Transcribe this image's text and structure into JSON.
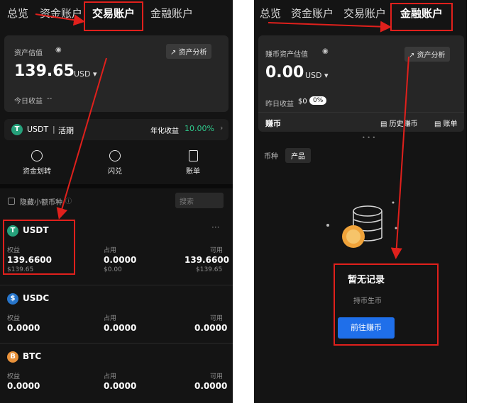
{
  "left": {
    "tabs": [
      "总览",
      "资金账户",
      "交易账户",
      "金融账户"
    ],
    "asset_label": "资产估值",
    "asset_value": "139.65",
    "asset_unit": "USD",
    "analysis_btn": "资产分析",
    "today_label": "今日收益",
    "today_value": "--",
    "promo_coin": "USDT",
    "promo_type": "活期",
    "promo_label": "年化收益",
    "promo_value": "10.00%",
    "actions": [
      "资金划转",
      "闪兑",
      "账单"
    ],
    "hide_small": "隐藏小额币种",
    "search_placeholder": "搜索",
    "columns": [
      "权益",
      "占用",
      "可用"
    ],
    "coins": [
      {
        "name": "USDT",
        "equity": "139.6600",
        "equity_usd": "$139.65",
        "used": "0.0000",
        "used_usd": "$0.00",
        "avail": "139.6600",
        "avail_usd": "$139.65"
      },
      {
        "name": "USDC",
        "equity": "0.0000",
        "used": "0.0000",
        "avail": "0.0000"
      },
      {
        "name": "BTC",
        "equity": "0.0000",
        "used": "0.0000",
        "avail": "0.0000"
      }
    ]
  },
  "right": {
    "tabs": [
      "总览",
      "资金账户",
      "交易账户",
      "金融账户"
    ],
    "asset_label": "赚币资产估值",
    "asset_value": "0.00",
    "asset_unit": "USD",
    "analysis_btn": "资产分析",
    "yesterday_label": "昨日收益",
    "yesterday_value": "$0",
    "yesterday_pct": "0%",
    "earn_label": "赚币",
    "history_label": "历史赚币",
    "bill_label": "账单",
    "subtabs": [
      "币种",
      "产品"
    ],
    "empty_title": "暂无记录",
    "empty_sub": "持币生币",
    "goto_btn": "前往赚币"
  },
  "colors": {
    "background": "#141414",
    "card": "#262626",
    "accent_green": "#2fc98c",
    "annotation_red": "#e0201c",
    "button_blue": "#1f6fea"
  }
}
